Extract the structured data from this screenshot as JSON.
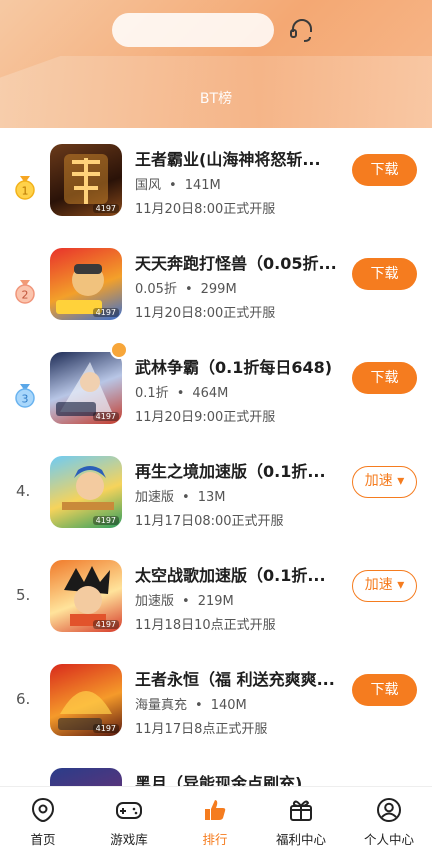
{
  "header": {
    "board_label": "BT榜",
    "icons": {
      "support": "headset-icon"
    },
    "colors": {
      "accent": "#f57c1f",
      "banner": "#f4a873"
    }
  },
  "games": [
    {
      "rank": "1",
      "rank_style": "gold-medal",
      "title": "王者霸业(山海神将怒斩...",
      "category": "国风",
      "size": "141M",
      "date": "11月20日8:00正式开服",
      "button": "下载",
      "thumb_tag": "4197"
    },
    {
      "rank": "2",
      "rank_style": "silver-medal",
      "title": "天天奔跑打怪兽（0.05折...",
      "category": "0.05折",
      "size": "299M",
      "date": "11月20日8:00正式开服",
      "button": "下载",
      "thumb_tag": "4197"
    },
    {
      "rank": "3",
      "rank_style": "bronze-medal",
      "title": "武林争霸（0.1折每日648)",
      "category": "0.1折",
      "size": "464M",
      "date": "11月20日9:00正式开服",
      "button": "下载",
      "thumb_tag": "4197"
    },
    {
      "rank": "4.",
      "rank_style": "number",
      "title": "再生之境加速版（0.1折...",
      "category": "加速版",
      "size": "13M",
      "date": "11月17日08:00正式开服",
      "button": "加速",
      "thumb_tag": "4197"
    },
    {
      "rank": "5.",
      "rank_style": "number",
      "title": "太空战歌加速版（0.1折...",
      "category": "加速版",
      "size": "219M",
      "date": "11月18日10点正式开服",
      "button": "加速",
      "thumb_tag": "4197"
    },
    {
      "rank": "6.",
      "rank_style": "number",
      "title": "王者永恒（福 利送充爽爽...",
      "category": "海量真充",
      "size": "140M",
      "date": "11月17日8点正式开服",
      "button": "下载",
      "thumb_tag": "4197"
    },
    {
      "rank": "",
      "rank_style": "number",
      "title": "黑月（异能现金点刷充)",
      "category": "",
      "size": "",
      "date": "",
      "button": "",
      "thumb_tag": ""
    }
  ],
  "bottom_nav": [
    {
      "label": "首页",
      "icon": "home-icon"
    },
    {
      "label": "游戏库",
      "icon": "gamepad-icon"
    },
    {
      "label": "排行",
      "icon": "thumbs-up-icon",
      "active": true
    },
    {
      "label": "福利中心",
      "icon": "gift-icon"
    },
    {
      "label": "个人中心",
      "icon": "user-icon"
    }
  ]
}
